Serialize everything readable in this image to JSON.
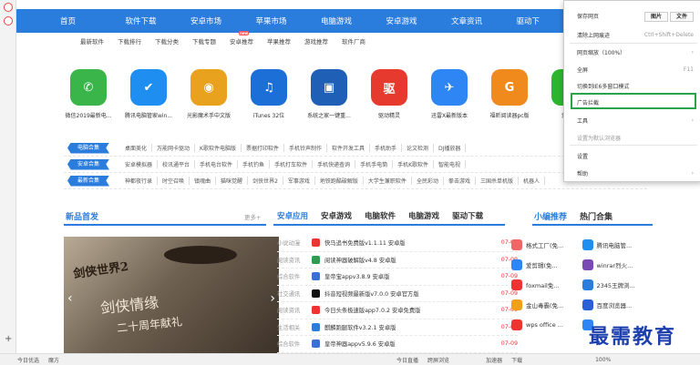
{
  "nav": [
    "首页",
    "软件下载",
    "安卓市场",
    "苹果市场",
    "电脑游戏",
    "安卓游戏",
    "文章资讯",
    "驱动下"
  ],
  "subnav": [
    "最新软件",
    "下载排行",
    "下载分类",
    "下载专题",
    "安卓推荐",
    "苹果推荐",
    "游戏推荐",
    "软件厂商"
  ],
  "subnav_badge": "new",
  "apps": [
    {
      "name": "微信2019最新电...",
      "color": "#3ab54a",
      "glyph": "✆"
    },
    {
      "name": "腾讯电脑管家win...",
      "color": "#1f8ef1",
      "glyph": "✔"
    },
    {
      "name": "光影魔术手中文版",
      "color": "#e8a21d",
      "glyph": "◉"
    },
    {
      "name": "iTunes 32位",
      "color": "#1c6fd6",
      "glyph": "♫"
    },
    {
      "name": "系统之家一键重...",
      "color": "#1f5fb5",
      "glyph": "▣"
    },
    {
      "name": "驱动精灵",
      "color": "#e63a2e",
      "glyph": "驱"
    },
    {
      "name": "迅雷X最新版本",
      "color": "#2e86f5",
      "glyph": "✈"
    },
    {
      "name": "福昕阅读器pc版",
      "color": "#f08a1c",
      "glyph": "G"
    },
    {
      "name": "爱奇艺",
      "color": "#2eb52e",
      "glyph": "▶"
    }
  ],
  "categories": [
    {
      "tag": "电脑合集",
      "items": [
        "桌面美化",
        "万能网卡驱动",
        "K歌软件电脑版",
        "票据打印软件",
        "手机铃声制作",
        "软件开发工具",
        "手机助手",
        "论文检测",
        "DJ播放器"
      ]
    },
    {
      "tag": "安卓合集",
      "items": [
        "安卓模拟器",
        "校讯通平台",
        "手机电台软件",
        "手机钓鱼",
        "手机打车软件",
        "手机快递查询",
        "手机手电筒",
        "手机K歌软件",
        "智能电视"
      ]
    },
    {
      "tag": "最新合集",
      "items": [
        "神都夜行录",
        "时空召唤",
        "镇魂曲",
        "猫咪觉醒",
        "剑侠世界2",
        "军事游戏",
        "地铁跑酷破解版",
        "大学生兼职软件",
        "全民彩动",
        "拳击游戏",
        "三国杀单机版",
        "机器人"
      ]
    }
  ],
  "new_release_title": "新品首发",
  "more_label": "更多+",
  "tabs": [
    "安卓应用",
    "安卓游戏",
    "电脑软件",
    "电脑游戏",
    "驱动下载"
  ],
  "banner": {
    "t1": "剑侠世界2",
    "t2": "剑侠情缘",
    "t3": "二十周年献礼"
  },
  "list": [
    {
      "cat": "小说动漫",
      "name": "快马追书免费版v1.1.11 安卓版",
      "date": "07-09",
      "color": "#e33"
    },
    {
      "cat": "阅读资讯",
      "name": "阅读神器破解版v4.8 安卓版",
      "date": "07-09",
      "color": "#2e9b4e"
    },
    {
      "cat": "综合软件",
      "name": "皇帝宝appv3.8.9 安卓版",
      "date": "07-09",
      "color": "#3a6fd6"
    },
    {
      "cat": "社交通讯",
      "name": "抖音短视频最新版v7.0.0 安卓官方版",
      "date": "07-09",
      "color": "#111"
    },
    {
      "cat": "阅读资讯",
      "name": "今日头条极速版app7.0.2 安卓免费版",
      "date": "07-09",
      "color": "#e33"
    },
    {
      "cat": "生活相关",
      "name": "麒麟跑腿软件v3.2.1 安卓版",
      "date": "07-09",
      "color": "#2b7ddd"
    },
    {
      "cat": "综合软件",
      "name": "皇帝神器appv5.9.6 安卓版",
      "date": "07-09",
      "color": "#3a6fd6"
    }
  ],
  "editor_title": "小编推荐",
  "hot_title": "热门合集",
  "editor_list": [
    {
      "left": "格式工厂(免...",
      "lc": "#e66",
      "right": "腾讯电脑管...",
      "rc": "#1f8ef1"
    },
    {
      "left": "爱剪辑(免...",
      "lc": "#2e86f5",
      "right": "winrar烈火...",
      "rc": "#7a4ab3"
    },
    {
      "left": "foxmail免...",
      "lc": "#e33",
      "right": "2345王牌浏...",
      "rc": "#2b7ddd"
    },
    {
      "left": "金山毒霸(免...",
      "lc": "#f0a01c",
      "right": "百度浏览器...",
      "rc": "#2b5fd6"
    },
    {
      "left": "wps office ...",
      "lc": "#e33",
      "right": "",
      "rc": "#2e86f5"
    }
  ],
  "menu": {
    "save_page": "保存网页",
    "btn_image": "图片",
    "btn_text": "文件",
    "clear": "清除上网痕迹",
    "clear_key": "Ctrl+Shift+Delete",
    "zoom": "网页缩放（100%）",
    "fullscreen": "全屏",
    "fullscreen_key": "F11",
    "switch_ie": "切换到IE6多窗口模式",
    "adblock": "广告拦截",
    "tools": "工具",
    "set_default": "设置为默认浏览器",
    "settings": "设置",
    "help": "帮助"
  },
  "status": [
    "今日优选",
    "魔方",
    "今日直播",
    "跨屏浏览",
    "加速器",
    "下载",
    "100%"
  ],
  "watermark": "最需教育"
}
